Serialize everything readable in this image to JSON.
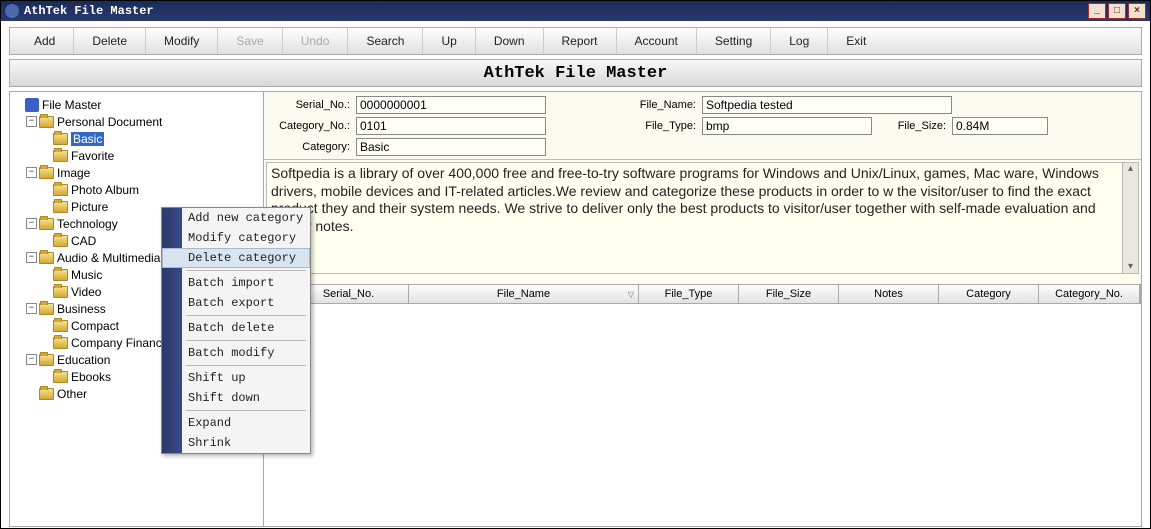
{
  "window": {
    "title": "AthTek File Master"
  },
  "toolbar": {
    "add": "Add",
    "delete": "Delete",
    "modify": "Modify",
    "save": "Save",
    "undo": "Undo",
    "search": "Search",
    "up": "Up",
    "down": "Down",
    "report": "Report",
    "account": "Account",
    "setting": "Setting",
    "log": "Log",
    "exit": "Exit"
  },
  "banner": {
    "title": "AthTek File Master"
  },
  "tree": {
    "root": "File Master",
    "n0": "Personal Document",
    "n0a": "Basic",
    "n0b": "Favorite",
    "n1": "Image",
    "n1a": "Photo Album",
    "n1b": "Picture",
    "n2": "Technology",
    "n2a": "CAD",
    "n3": "Audio & Multimedia",
    "n3a": "Music",
    "n3b": "Video",
    "n4": "Business",
    "n4a": "Compact",
    "n4b": "Company Finance",
    "n5": "Education",
    "n5a": "Ebooks",
    "n6": "Other"
  },
  "form": {
    "serial_lbl": "Serial_No.:",
    "serial": "0000000001",
    "catno_lbl": "Category_No.:",
    "catno": "0101",
    "cat_lbl": "Category:",
    "cat": "Basic",
    "fname_lbl": "File_Name:",
    "fname": "Softpedia tested",
    "ftype_lbl": "File_Type:",
    "ftype": "bmp",
    "fsize_lbl": "File_Size:",
    "fsize": "0.84M"
  },
  "desc": "Softpedia is a library of over 400,000 free and free-to-try software programs for Windows and Unix/Linux, games, Mac ware, Windows drivers, mobile devices and IT-related articles.We review and categorize these products in order to w the visitor/user to find the exact product they and their system needs. We strive to deliver only the best products to visitor/user together with self-made evaluation and review notes.",
  "grid": {
    "c0": "Serial_No.",
    "c1": "File_Name",
    "c2": "File_Type",
    "c3": "File_Size",
    "c4": "Notes",
    "c5": "Category",
    "c6": "Category_No."
  },
  "ctx": {
    "i0": "Add new category",
    "i1": "Modify category",
    "i2": "Delete category",
    "i3": "Batch import",
    "i4": "Batch export",
    "i5": "Batch delete",
    "i6": "Batch modify",
    "i7": "Shift up",
    "i8": "Shift down",
    "i9": "Expand",
    "i10": "Shrink"
  }
}
